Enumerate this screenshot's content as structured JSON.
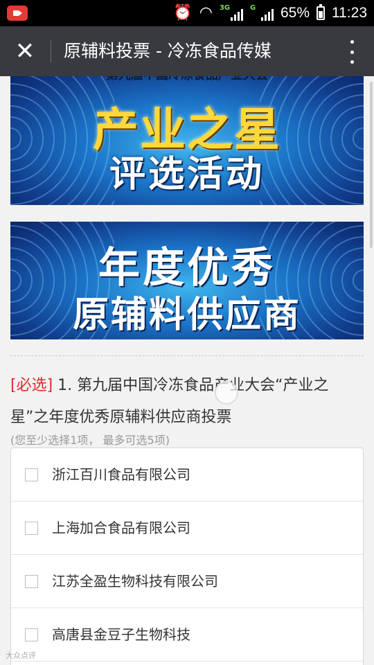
{
  "status_bar": {
    "network_1": "3G",
    "network_2": "G",
    "battery": "65%",
    "time": "11:23",
    "icons": [
      "screen-record-icon",
      "alarm-icon",
      "wifi-icon",
      "signal-icon",
      "signal-icon",
      "battery-icon"
    ]
  },
  "titlebar": {
    "title": "原辅料投票 - 冷冻食品传媒",
    "close_icon": "close-icon",
    "more_icon": "more-vertical-icon"
  },
  "banner1": {
    "top_text": "第九届中国冷冻食品产业大会",
    "line1": "产业之星",
    "line2": "评选活动"
  },
  "banner2": {
    "line1": "年度优秀",
    "line2": "原辅料供应商"
  },
  "question": {
    "required_tag": "[必选]",
    "text": " 1. 第九届中国冷冻食品产业大会“产业之星”之年度优秀原辅料供应商投票",
    "hint": "(您至少选择1项， 最多可选5项)"
  },
  "options": [
    {
      "label": "浙江百川食品有限公司",
      "checked": false
    },
    {
      "label": "上海加合食品有限公司",
      "checked": false
    },
    {
      "label": "江苏全盈生物科技有限公司",
      "checked": false
    },
    {
      "label": "高唐县金豆子生物科技",
      "checked": false
    }
  ],
  "watermark": "大众点评",
  "colors": {
    "titlebar": "#393a3f",
    "required": "#e02a2a",
    "banner_blue": "#1b73c7",
    "banner_gold": "#ffd83a"
  }
}
